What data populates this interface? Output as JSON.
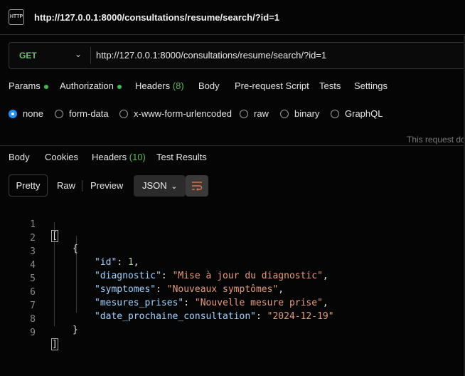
{
  "title": {
    "url": "http://127.0.0.1:8000/consultations/resume/search/?id=1",
    "icon": "HTTP"
  },
  "request": {
    "method": "GET",
    "url": "http://127.0.0.1:8000/consultations/resume/search/?id=1",
    "tabs": [
      "Params",
      "Authorization",
      "Headers",
      "Body",
      "Pre-request Script",
      "Tests",
      "Settings"
    ],
    "headers_count": "(8)",
    "body_types": [
      "none",
      "form-data",
      "x-www-form-urlencoded",
      "raw",
      "binary",
      "GraphQL"
    ],
    "selected_body": "none",
    "note": "This request do"
  },
  "response": {
    "tabs": [
      "Body",
      "Cookies",
      "Headers",
      "Test Results"
    ],
    "headers_count": "(10)",
    "view_modes": [
      "Pretty",
      "Raw",
      "Preview"
    ],
    "format": "JSON",
    "line_numbers": [
      "1",
      "2",
      "3",
      "4",
      "5",
      "6",
      "7",
      "8",
      "9"
    ],
    "json": {
      "open_bracket": "[",
      "open_brace": "{",
      "close_brace": "}",
      "close_bracket": "]",
      "fields": [
        {
          "key": "\"id\"",
          "value": "1",
          "type": "number",
          "comma": ","
        },
        {
          "key": "\"diagnostic\"",
          "value": "\"Mise à jour du diagnostic\"",
          "type": "string",
          "comma": ","
        },
        {
          "key": "\"symptomes\"",
          "value": "\"Nouveaux symptômes\"",
          "type": "string",
          "comma": ","
        },
        {
          "key": "\"mesures_prises\"",
          "value": "\"Nouvelle mesure prise\"",
          "type": "string",
          "comma": ","
        },
        {
          "key": "\"date_prochaine_consultation\"",
          "value": "\"2024-12-19\"",
          "type": "string",
          "comma": ""
        }
      ]
    }
  },
  "colors": {
    "accent": "#1e8fff",
    "get_method": "#6cc07a",
    "json_key": "#9fd3ff",
    "json_string": "#e69a7a",
    "dot": "#3fb950"
  }
}
